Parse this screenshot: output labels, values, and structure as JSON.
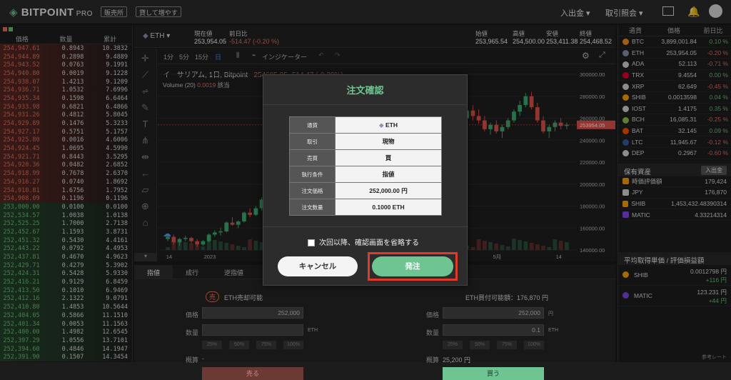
{
  "header": {
    "logo": "BITPOINT",
    "logo_pro": "PRO",
    "btn_shop": "販売所",
    "btn_lend": "貸して増やす",
    "nav_deposit": "入出金 ▾",
    "nav_history": "取引照会 ▾"
  },
  "orderbook": {
    "headers": [
      "価格",
      "数量",
      "累計"
    ],
    "asks": [
      [
        "254,947.61",
        "0.8943",
        "10.3832"
      ],
      [
        "254,944.89",
        "0.2898",
        "9.4889"
      ],
      [
        "254,943.52",
        "0.0763",
        "9.1991"
      ],
      [
        "254,940.80",
        "0.0019",
        "9.1228"
      ],
      [
        "254,938.07",
        "1.4213",
        "9.1209"
      ],
      [
        "254,936.71",
        "1.0532",
        "7.6996"
      ],
      [
        "254,935.34",
        "0.1598",
        "6.6464"
      ],
      [
        "254,933.98",
        "0.6821",
        "6.4866"
      ],
      [
        "254,931.26",
        "0.4812",
        "5.8045"
      ],
      [
        "254,929.89",
        "0.1476",
        "5.3233"
      ],
      [
        "254,927.17",
        "0.5751",
        "5.1757"
      ],
      [
        "254,925.80",
        "0.0016",
        "4.6006"
      ],
      [
        "254,924.45",
        "1.0695",
        "4.5990"
      ],
      [
        "254,921.71",
        "0.8443",
        "3.5295"
      ],
      [
        "254,920.36",
        "0.0482",
        "2.6852"
      ],
      [
        "254,918.99",
        "0.7678",
        "2.6370"
      ],
      [
        "254,916.27",
        "0.0740",
        "1.8692"
      ],
      [
        "254,910.81",
        "1.6756",
        "1.7952"
      ],
      [
        "254,908.09",
        "0.1196",
        "0.1196"
      ]
    ],
    "bids": [
      [
        "253,000.00",
        "0.0100",
        "0.0100"
      ],
      [
        "252,534.57",
        "1.0038",
        "1.0138"
      ],
      [
        "252,525.25",
        "1.7000",
        "2.7138"
      ],
      [
        "252,452.67",
        "1.1593",
        "3.8731"
      ],
      [
        "252,451.32",
        "0.5430",
        "4.4161"
      ],
      [
        "252,443.22",
        "0.0792",
        "4.4953"
      ],
      [
        "252,437.81",
        "0.4670",
        "4.9623"
      ],
      [
        "252,429.71",
        "0.4279",
        "5.3902"
      ],
      [
        "252,424.31",
        "0.5428",
        "5.9330"
      ],
      [
        "252,416.21",
        "0.9129",
        "6.8459"
      ],
      [
        "252,413.50",
        "0.1010",
        "6.9469"
      ],
      [
        "252,412.16",
        "2.1322",
        "9.0791"
      ],
      [
        "252,410.80",
        "1.4853",
        "10.5644"
      ],
      [
        "252,404.05",
        "0.5866",
        "11.1510"
      ],
      [
        "252,401.34",
        "0.0053",
        "11.1563"
      ],
      [
        "252,400.00",
        "1.4982",
        "12.6545"
      ],
      [
        "252,397.29",
        "1.0556",
        "13.7101"
      ],
      [
        "252,394.60",
        "0.4846",
        "14.1947"
      ],
      [
        "252,391.90",
        "0.1507",
        "14.3454"
      ]
    ]
  },
  "ticker": {
    "pair": "ETH",
    "cur_label": "現在値",
    "cur": "253,954.05",
    "chg_label": "前日比",
    "chg": "-514.47 (-0.20 %)",
    "open_label": "始値",
    "open": "253,965.54",
    "high_label": "高値",
    "high": "254,500.00",
    "low_label": "安値",
    "low": "253,411.38",
    "close_label": "終値",
    "close": "254,468.52"
  },
  "chart": {
    "intervals": [
      "1分",
      "5分",
      "15分",
      "日"
    ],
    "indicator": "インジケーター",
    "title": "イーサリアム, 1日, Bitpoint",
    "ohlc": "254685.05 -514.47 (-0.20%)",
    "volume": "Volume (20)",
    "vol_val": "0.0019",
    "vol_note": "該当",
    "price_tag": "253954.05",
    "y_ticks": [
      "300000.00",
      "280000.00",
      "260000.00",
      "240000.00",
      "220000.00",
      "200000.00",
      "180000.00",
      "160000.00",
      "140000.00"
    ],
    "x_ticks": [
      "14",
      "2023",
      "14",
      "5月",
      "14"
    ],
    "candles": [
      [
        150,
        155,
        148,
        152
      ],
      [
        152,
        154,
        145,
        147
      ],
      [
        147,
        151,
        144,
        150
      ],
      [
        150,
        153,
        148,
        151
      ],
      [
        151,
        152,
        146,
        148
      ],
      [
        148,
        150,
        143,
        145
      ],
      [
        145,
        149,
        144,
        148
      ],
      [
        148,
        155,
        147,
        154
      ],
      [
        154,
        158,
        152,
        156
      ],
      [
        156,
        160,
        153,
        157
      ],
      [
        157,
        166,
        156,
        165
      ],
      [
        165,
        170,
        162,
        163
      ],
      [
        163,
        167,
        160,
        166
      ],
      [
        166,
        175,
        165,
        174
      ],
      [
        174,
        178,
        170,
        172
      ],
      [
        172,
        180,
        171,
        178
      ],
      [
        178,
        188,
        176,
        186
      ],
      [
        186,
        192,
        183,
        185
      ],
      [
        185,
        190,
        180,
        188
      ],
      [
        188,
        200,
        186,
        198
      ],
      [
        198,
        205,
        195,
        200
      ],
      [
        200,
        212,
        198,
        210
      ],
      [
        210,
        215,
        205,
        207
      ],
      [
        207,
        213,
        203,
        212
      ],
      [
        212,
        220,
        208,
        216
      ],
      [
        216,
        222,
        210,
        214
      ],
      [
        214,
        218,
        205,
        208
      ],
      [
        208,
        212,
        200,
        203
      ],
      [
        203,
        209,
        199,
        207
      ],
      [
        207,
        215,
        205,
        213
      ],
      [
        213,
        220,
        210,
        218
      ],
      [
        218,
        225,
        214,
        222
      ],
      [
        222,
        230,
        219,
        228
      ],
      [
        228,
        233,
        222,
        225
      ],
      [
        225,
        228,
        216,
        219
      ],
      [
        219,
        226,
        217,
        224
      ],
      [
        224,
        232,
        222,
        230
      ],
      [
        230,
        238,
        228,
        236
      ],
      [
        236,
        240,
        230,
        232
      ],
      [
        232,
        237,
        226,
        234
      ],
      [
        234,
        242,
        232,
        240
      ],
      [
        240,
        246,
        236,
        238
      ],
      [
        238,
        244,
        233,
        242
      ],
      [
        242,
        250,
        240,
        248
      ],
      [
        248,
        254,
        244,
        246
      ],
      [
        246,
        252,
        241,
        250
      ],
      [
        250,
        258,
        247,
        255
      ],
      [
        255,
        262,
        250,
        252
      ],
      [
        252,
        258,
        245,
        248
      ],
      [
        248,
        255,
        244,
        253
      ],
      [
        253,
        262,
        251,
        260
      ],
      [
        260,
        270,
        256,
        267
      ],
      [
        267,
        272,
        258,
        262
      ],
      [
        262,
        268,
        255,
        258
      ],
      [
        258,
        262,
        248,
        250
      ],
      [
        250,
        256,
        245,
        254
      ],
      [
        254,
        258,
        246,
        248
      ],
      [
        248,
        254,
        242,
        252
      ],
      [
        252,
        260,
        250,
        258
      ],
      [
        258,
        268,
        256,
        266
      ],
      [
        266,
        276,
        262,
        272
      ],
      [
        272,
        283,
        270,
        280
      ],
      [
        280,
        284,
        268,
        270
      ],
      [
        270,
        274,
        256,
        258
      ],
      [
        258,
        262,
        246,
        248
      ],
      [
        248,
        254,
        242,
        252
      ],
      [
        252,
        258,
        248,
        256
      ],
      [
        256,
        260,
        250,
        253
      ],
      [
        253,
        256,
        250,
        254
      ]
    ]
  },
  "tabs": [
    "指値",
    "成行",
    "逆指値"
  ],
  "sell": {
    "badge": "売",
    "avail": "ETH売却可能",
    "price_label": "価格",
    "price": "252,000",
    "qty_label": "数量",
    "unit": "ETH",
    "pcts": [
      "25%",
      "50%",
      "75%",
      "100%"
    ],
    "est_label": "概算",
    "est": "-",
    "btn": "売る"
  },
  "buy": {
    "avail": "ETH買付可能額：176,870 円",
    "price_label": "価格",
    "price": "252,000",
    "qty_label": "数量",
    "qty": "0.1",
    "unit_jpy": "円",
    "unit": "ETH",
    "pcts": [
      "25%",
      "50%",
      "75%",
      "100%"
    ],
    "est_label": "概算",
    "est": "25,200 円",
    "btn": "買う"
  },
  "right": {
    "headers": [
      "通貨",
      "価格",
      "前日比"
    ],
    "coins": [
      [
        "BTC",
        "3,899,001.84",
        "0.10 %",
        "#f7931a",
        "#6ec27a"
      ],
      [
        "ETH",
        "253,954.05",
        "-0.20 %",
        "#8a92b2",
        "#e8725e"
      ],
      [
        "ADA",
        "52.113",
        "-0.71 %",
        "#d8d8d8",
        "#e8725e"
      ],
      [
        "TRX",
        "9.4554",
        "0.00 %",
        "#ef0027",
        "#6ec27a"
      ],
      [
        "XRP",
        "62.649",
        "-0.45 %",
        "#d8d8d8",
        "#e8725e"
      ],
      [
        "SHIB",
        "0.0013598",
        "0.04 %",
        "#ffa409",
        "#6ec27a"
      ],
      [
        "IOST",
        "1.4175",
        "0.35 %",
        "#d8d8d8",
        "#6ec27a"
      ],
      [
        "BCH",
        "16,085.31",
        "-0.25 %",
        "#8dc351",
        "#e8725e"
      ],
      [
        "BAT",
        "32.145",
        "0.09 %",
        "#ff5000",
        "#6ec27a"
      ],
      [
        "LTC",
        "11,945.67",
        "-0.12 %",
        "#345d9d",
        "#e8725e"
      ],
      [
        "DEP",
        "0.2967",
        "-0.60 %",
        "#d8d8d8",
        "#e8725e"
      ]
    ],
    "holdings_title": "保有資産",
    "holdings_btn": "入出金",
    "holdings": [
      [
        "時価評価額",
        "179,424"
      ],
      [
        "JPY",
        "176,870"
      ],
      [
        "SHIB",
        "1,453,432.48390314"
      ],
      [
        "MATIC",
        "4.33214314"
      ]
    ],
    "avg_title": "平均取得単価 / 評価損益額",
    "avg": [
      [
        "SHIB",
        "0.0012798 円",
        "+116 円"
      ],
      [
        "MATIC",
        "123.231 円",
        "+44 円"
      ]
    ],
    "footer": "参考レート"
  },
  "modal": {
    "title": "注文確認",
    "rows": [
      [
        "通貨",
        "ETH"
      ],
      [
        "取引",
        "現物"
      ],
      [
        "売買",
        "買"
      ],
      [
        "執行条件",
        "指値"
      ],
      [
        "注文価格",
        "252,000.00 円"
      ],
      [
        "注文数量",
        "0.1000 ETH"
      ]
    ],
    "skip": "次回以降、確認画面を省略する",
    "cancel": "キャンセル",
    "submit": "発注",
    "accent": "#6fc592",
    "highlight": "#e03a2a"
  }
}
